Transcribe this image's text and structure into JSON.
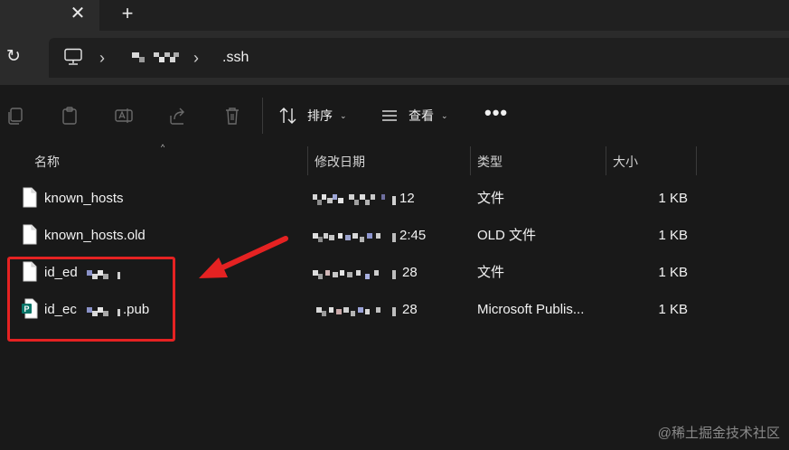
{
  "tabbar": {
    "close_icon": "close-icon",
    "new_tab_icon": "plus-icon"
  },
  "address": {
    "refresh_icon": "refresh-icon",
    "pc_icon": "computer-icon",
    "current_folder": ".ssh"
  },
  "toolbar": {
    "sort_label": "排序",
    "view_label": "查看",
    "more_label": "•••"
  },
  "columns": {
    "name": "名称",
    "date": "修改日期",
    "type": "类型",
    "size": "大小"
  },
  "files": [
    {
      "name": "known_hosts",
      "date_visible": "12",
      "type": "文件",
      "size": "1 KB",
      "icon": "file-icon"
    },
    {
      "name": "known_hosts.old",
      "date_visible": "2:45",
      "type": "OLD 文件",
      "size": "1 KB",
      "icon": "file-icon"
    },
    {
      "name_prefix": "id_ed",
      "name_suffix": "",
      "date_visible": "28",
      "type": "文件",
      "size": "1 KB",
      "icon": "file-icon"
    },
    {
      "name_prefix": "id_ec",
      "name_suffix": ".pub",
      "date_visible": "28",
      "type": "Microsoft Publis...",
      "size": "1 KB",
      "icon": "publisher-icon"
    }
  ],
  "annotation": {
    "color": "#e52222"
  },
  "watermark": "@稀土掘金技术社区"
}
